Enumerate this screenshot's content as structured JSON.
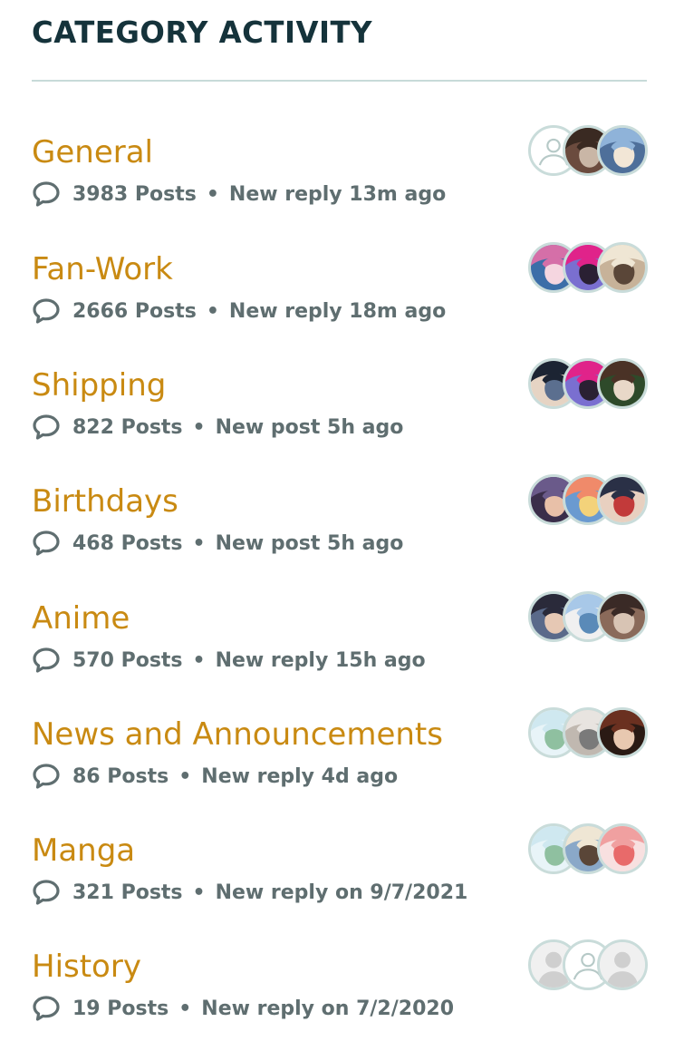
{
  "widget": {
    "title": "CATEGORY ACTIVITY"
  },
  "categories": [
    {
      "name": "General",
      "posts": "3983 Posts",
      "activity": "New reply 13m ago",
      "avatars": [
        {
          "type": "placeholder",
          "bg": "#ffffff"
        },
        {
          "type": "photo",
          "colors": [
            "#3a2a22",
            "#c9b6a6",
            "#6b4b3e"
          ]
        },
        {
          "type": "photo",
          "colors": [
            "#8fb3d9",
            "#f2e6d6",
            "#4e6f9a"
          ]
        }
      ]
    },
    {
      "name": "Fan-Work",
      "posts": "2666 Posts",
      "activity": "New reply 18m ago",
      "avatars": [
        {
          "type": "photo",
          "colors": [
            "#d56fa8",
            "#f5d6e0",
            "#3c6ea8"
          ]
        },
        {
          "type": "photo",
          "colors": [
            "#e0238a",
            "#2a2033",
            "#7a6fd0"
          ]
        },
        {
          "type": "photo",
          "colors": [
            "#efe6d4",
            "#5a4638",
            "#c7b299"
          ]
        }
      ]
    },
    {
      "name": "Shipping",
      "posts": "822 Posts",
      "activity": "New post 5h ago",
      "avatars": [
        {
          "type": "photo",
          "colors": [
            "#1c2433",
            "#5b6f8f",
            "#e6d4c4"
          ]
        },
        {
          "type": "photo",
          "colors": [
            "#e0238a",
            "#2a2033",
            "#7a6fd0"
          ]
        },
        {
          "type": "photo",
          "colors": [
            "#4a3226",
            "#e8d8c8",
            "#2e4a2a"
          ]
        }
      ]
    },
    {
      "name": "Birthdays",
      "posts": "468 Posts",
      "activity": "New post 5h ago",
      "avatars": [
        {
          "type": "photo",
          "colors": [
            "#6a5a8a",
            "#e8c0a8",
            "#3a2e4a"
          ]
        },
        {
          "type": "photo",
          "colors": [
            "#f08a6a",
            "#f3d27a",
            "#6a9ad0"
          ]
        },
        {
          "type": "photo",
          "colors": [
            "#2a3046",
            "#c23a3a",
            "#e8d0c0"
          ]
        }
      ]
    },
    {
      "name": "Anime",
      "posts": "570 Posts",
      "activity": "New reply 15h ago",
      "avatars": [
        {
          "type": "photo",
          "colors": [
            "#2a2a3a",
            "#e6c8b4",
            "#5a6a8a"
          ]
        },
        {
          "type": "photo",
          "colors": [
            "#a8c8e8",
            "#5a8ab8",
            "#f0f0f0"
          ]
        },
        {
          "type": "photo",
          "colors": [
            "#3a2a26",
            "#d8c4b4",
            "#8a6a5a"
          ]
        }
      ]
    },
    {
      "name": "News and Announcements",
      "posts": "86 Posts",
      "activity": "New reply 4d ago",
      "avatars": [
        {
          "type": "photo",
          "colors": [
            "#cfe8f0",
            "#8fc0a0",
            "#e8f4f8"
          ]
        },
        {
          "type": "photo",
          "colors": [
            "#e8e4e0",
            "#7a7a7a",
            "#c0b8b0"
          ]
        },
        {
          "type": "photo",
          "colors": [
            "#6a3020",
            "#e8c8b0",
            "#2a1a14"
          ]
        }
      ]
    },
    {
      "name": "Manga",
      "posts": "321 Posts",
      "activity": "New reply on 9/7/2021",
      "avatars": [
        {
          "type": "photo",
          "colors": [
            "#cfe8f0",
            "#8fc0a0",
            "#e8f4f8"
          ]
        },
        {
          "type": "photo",
          "colors": [
            "#efe6d4",
            "#5a4638",
            "#8aa8c8"
          ]
        },
        {
          "type": "photo",
          "colors": [
            "#f0a0a0",
            "#e86a6a",
            "#f8e0e0"
          ]
        }
      ]
    },
    {
      "name": "History",
      "posts": "19 Posts",
      "activity": "New reply on 7/2/2020",
      "avatars": [
        {
          "type": "silhouette",
          "bg": "#f0f0f0"
        },
        {
          "type": "placeholder",
          "bg": "#ffffff"
        },
        {
          "type": "silhouette",
          "bg": "#f0f0f0"
        }
      ]
    }
  ],
  "icons": {
    "post_count": "chat-bubble-icon"
  },
  "colors": {
    "heading": "#15333b",
    "category_name": "#c98a12",
    "meta": "#5f6e70",
    "rule": "#c7dbd9",
    "avatar_ring": "#c9dcda"
  }
}
